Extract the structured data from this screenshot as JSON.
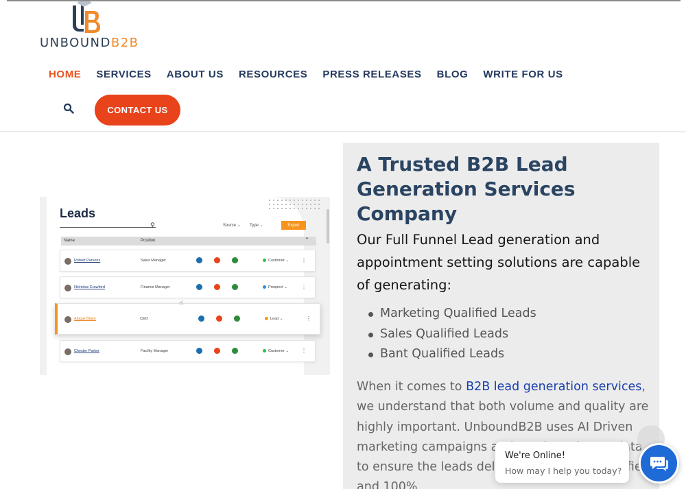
{
  "header": {
    "logo_text_prefix": "UNBOUND",
    "logo_text_suffix": "B2B",
    "nav": [
      {
        "label": "HOME",
        "active": true
      },
      {
        "label": "SERVICES"
      },
      {
        "label": "ABOUT US"
      },
      {
        "label": "RESOURCES"
      },
      {
        "label": "PRESS RELEASES"
      },
      {
        "label": "BLOG"
      },
      {
        "label": "WRITE FOR US"
      }
    ],
    "contact_label": "CONTACT US",
    "accent_color": "#e8431b",
    "brand_color": "#243a5e"
  },
  "leads_visual": {
    "title": "Leads",
    "source_label": "Source",
    "type_label": "Type",
    "export_label": "Export",
    "col_name": "Name",
    "col_position": "Position",
    "rows": [
      {
        "name": "Robert Parsons",
        "position": "Sales Manager",
        "status": "Customer",
        "status_color": "#2fbf4a"
      },
      {
        "name": "Nicholas Crawford",
        "position": "Finance Manager",
        "status": "Prospect",
        "status_color": "#2b8fe0"
      },
      {
        "name": "Abigail Blake",
        "position": "CEO",
        "status": "Lead",
        "status_color": "#f39a1e"
      },
      {
        "name": "Chester Parker",
        "position": "Facility Manager",
        "status": "Customer",
        "status_color": "#2fbf4a"
      }
    ]
  },
  "content": {
    "headline": "A Trusted B2B Lead Generation Services Company",
    "subheading": "Our Full Funnel Lead generation and appointment setting solutions are capable of generating:",
    "bullets": [
      "Marketing Qualified Leads",
      "Sales Qualified Leads",
      "Bant Qualified Leads"
    ],
    "para_before_link": "When it comes to ",
    "para_link": "B2B lead generation services",
    "para_after_link": ", we understand that both volume and quality are highly important. UnboundB2B uses AI Driven marketing campaigns and purchase intent data to ensure the leads delivered are 100% qualified and 100%"
  },
  "chat": {
    "title": "We're Online!",
    "subtitle": "How may I help you today?"
  }
}
